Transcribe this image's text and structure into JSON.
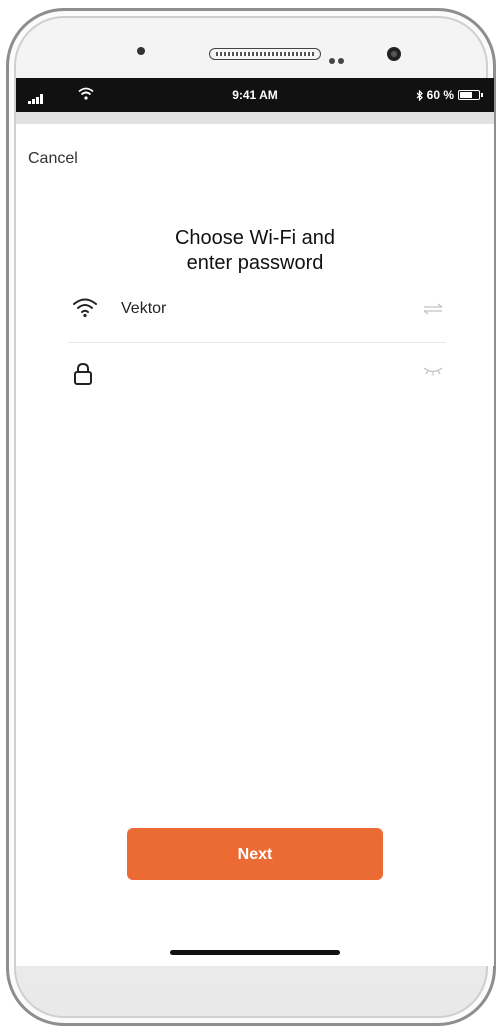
{
  "status_bar": {
    "time": "9:41 AM",
    "battery_text": "60 %",
    "bluetooth_icon": "bluetooth-icon",
    "battery_level": 0.6
  },
  "nav": {
    "cancel_label": "Cancel"
  },
  "title": {
    "line1": "Choose Wi-Fi and",
    "line2": "enter password"
  },
  "wifi_row": {
    "ssid": "Vektor",
    "icon": "wifi-icon",
    "switch_icon": "swap-arrows-icon"
  },
  "password_row": {
    "value": "",
    "placeholder": "",
    "icon": "lock-icon",
    "toggle_icon": "eye-closed-icon"
  },
  "next_button": {
    "label": "Next",
    "color": "#ec6a33"
  }
}
